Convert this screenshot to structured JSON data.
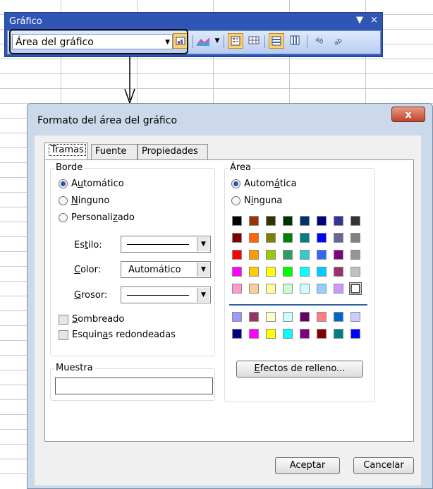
{
  "toolbar": {
    "title": "Gráfico",
    "dropdown_glyph": "▼",
    "close_glyph": "×",
    "chart_element_value": "Área del gráfico",
    "icons": [
      "format-selected-object-icon",
      "chart-type-icon",
      "legend-icon",
      "data-table-icon",
      "by-row-icon",
      "by-column-icon",
      "angle-text-downward-icon",
      "angle-text-upward-icon"
    ]
  },
  "dialog": {
    "title": "Formato del área del gráfico",
    "close_label": "x",
    "tabs": [
      {
        "label": "Tramas",
        "active": true
      },
      {
        "label": "Fuente",
        "active": false
      },
      {
        "label": "Propiedades",
        "active": false
      }
    ],
    "border": {
      "legend": "Borde",
      "options": [
        {
          "pre": "A",
          "u": "u",
          "post": "tomático",
          "selected": true
        },
        {
          "pre": "",
          "u": "N",
          "post": "inguno",
          "selected": false
        },
        {
          "pre": "Personali",
          "u": "z",
          "post": "ado",
          "selected": false
        }
      ],
      "style_label": {
        "pre": "Es",
        "u": "t",
        "post": "ilo:"
      },
      "color_label": {
        "pre": "",
        "u": "C",
        "post": "olor:"
      },
      "color_value": "Automático",
      "weight_label": {
        "pre": "",
        "u": "G",
        "post": "rosor:"
      },
      "shadow": {
        "pre": "",
        "u": "S",
        "post": "ombreado",
        "checked": false
      },
      "rounded": {
        "pre": "Esquin",
        "u": "a",
        "post": "s redondeadas",
        "checked": false
      }
    },
    "sample": {
      "legend": "Muestra"
    },
    "area": {
      "legend": "Área",
      "options": [
        {
          "pre": "Autom",
          "u": "á",
          "post": "tica",
          "selected": true
        },
        {
          "pre": "N",
          "u": "i",
          "post": "nguna",
          "selected": false
        }
      ],
      "palette_main": [
        [
          "#000000",
          "#993300",
          "#333300",
          "#003300",
          "#003366",
          "#000080",
          "#333399",
          "#333333"
        ],
        [
          "#800000",
          "#ff6600",
          "#808000",
          "#008000",
          "#008080",
          "#0000ff",
          "#666699",
          "#808080"
        ],
        [
          "#ff0000",
          "#ff9900",
          "#99cc00",
          "#339966",
          "#33cccc",
          "#3366ff",
          "#800080",
          "#969696"
        ],
        [
          "#ff00ff",
          "#ffcc00",
          "#ffff00",
          "#00ff00",
          "#00ffff",
          "#00ccff",
          "#993366",
          "#c0c0c0"
        ],
        [
          "#ff99cc",
          "#ffcc99",
          "#ffff99",
          "#ccffcc",
          "#ccffff",
          "#99ccff",
          "#cc99ff",
          "#ffffff"
        ]
      ],
      "palette_chart": [
        [
          "#9999ff",
          "#993366",
          "#ffffcc",
          "#ccffff",
          "#660066",
          "#ff8080",
          "#0066cc",
          "#ccccff"
        ],
        [
          "#000080",
          "#ff00ff",
          "#ffff00",
          "#00ffff",
          "#800080",
          "#800000",
          "#008080",
          "#0000ff"
        ]
      ],
      "fill_effects": {
        "pre": "",
        "u": "E",
        "post": "fectos de relleno..."
      }
    },
    "ok_label": "Aceptar",
    "cancel_label": "Cancelar"
  }
}
